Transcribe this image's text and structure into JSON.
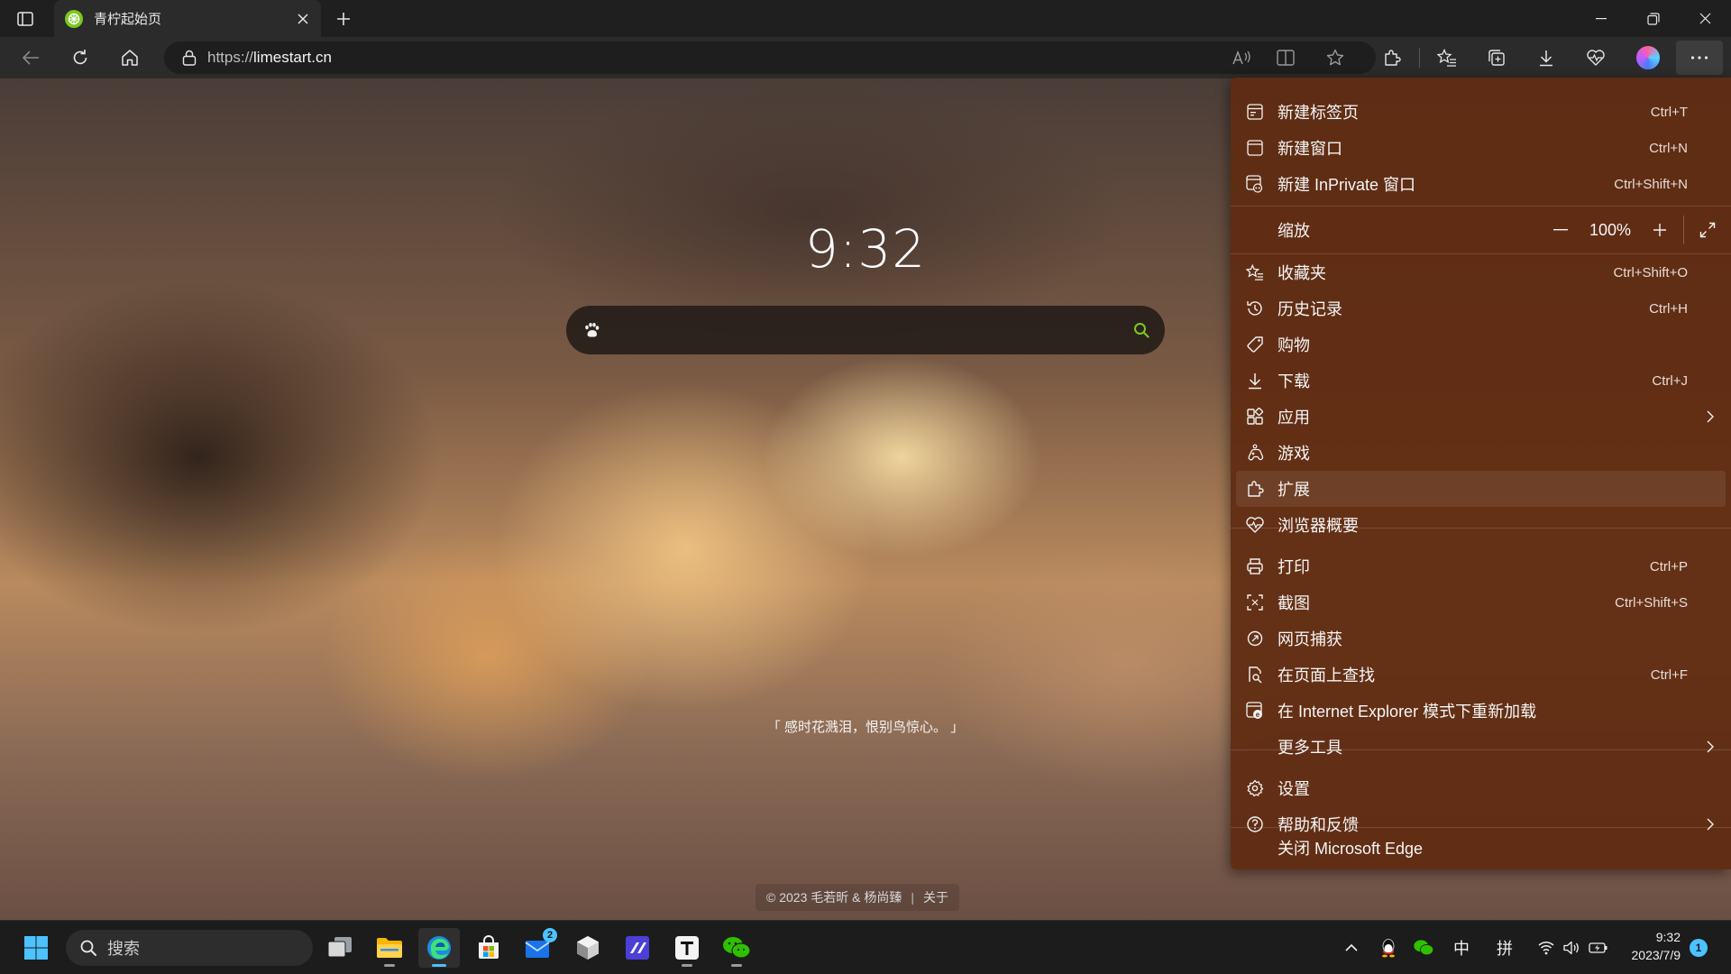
{
  "browser": {
    "tab": {
      "title": "青柠起始页",
      "favicon": "lime-icon"
    },
    "address": {
      "url_prefix": "https://",
      "url_host": "limestart.cn"
    }
  },
  "page": {
    "clock": "9:32",
    "search": {
      "placeholder": "",
      "engine_icon": "paw-icon"
    },
    "quote": "「 感时花溅泪，恨别鸟惊心。 」",
    "footer": {
      "copyright": "© 2023 毛若昕 & 杨尚臻",
      "divider": "|",
      "about": "关于"
    }
  },
  "menu": {
    "items": [
      {
        "label": "新建标签页",
        "shortcut": "Ctrl+T"
      },
      {
        "label": "新建窗口",
        "shortcut": "Ctrl+N"
      },
      {
        "label": "新建 InPrivate 窗口",
        "shortcut": "Ctrl+Shift+N"
      },
      {
        "label": "缩放",
        "zoom_value": "100%"
      },
      {
        "label": "收藏夹",
        "shortcut": "Ctrl+Shift+O"
      },
      {
        "label": "历史记录",
        "shortcut": "Ctrl+H"
      },
      {
        "label": "购物"
      },
      {
        "label": "下载",
        "shortcut": "Ctrl+J"
      },
      {
        "label": "应用"
      },
      {
        "label": "游戏"
      },
      {
        "label": "扩展"
      },
      {
        "label": "浏览器概要"
      },
      {
        "label": "打印",
        "shortcut": "Ctrl+P"
      },
      {
        "label": "截图",
        "shortcut": "Ctrl+Shift+S"
      },
      {
        "label": "网页捕获"
      },
      {
        "label": "在页面上查找",
        "shortcut": "Ctrl+F"
      },
      {
        "label": "在 Internet Explorer 模式下重新加载"
      },
      {
        "label": "更多工具"
      },
      {
        "label": "设置"
      },
      {
        "label": "帮助和反馈"
      },
      {
        "label": "关闭 Microsoft Edge"
      }
    ],
    "highlighted": "扩展"
  },
  "taskbar": {
    "search_label": "搜索",
    "mail_badge": "2",
    "tray": {
      "ime_lang": "中",
      "ime_mode": "拼"
    },
    "clock": {
      "time": "9:32",
      "date": "2023/7/9"
    },
    "notification_count": "1"
  },
  "colors": {
    "menu_bg": "#602c12",
    "accent": "#4cc2ff",
    "lime": "#7cc81e"
  }
}
